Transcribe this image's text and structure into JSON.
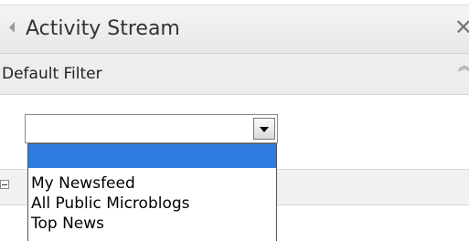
{
  "window": {
    "title": "Activity Stream",
    "close_icon": "close-icon",
    "collapse_icon": "left-arrow-icon"
  },
  "section": {
    "title": "Default Filter",
    "toggle_icon": "chevron-up-icon"
  },
  "filter_select": {
    "value": "",
    "options": [
      {
        "label": "",
        "selected": true
      },
      {
        "label": "My Newsfeed",
        "selected": false
      },
      {
        "label": "All Public Microblogs",
        "selected": false
      },
      {
        "label": "Top News",
        "selected": false
      }
    ]
  },
  "colors": {
    "selection": "#2f7de0",
    "section_bg": "#ededed"
  }
}
